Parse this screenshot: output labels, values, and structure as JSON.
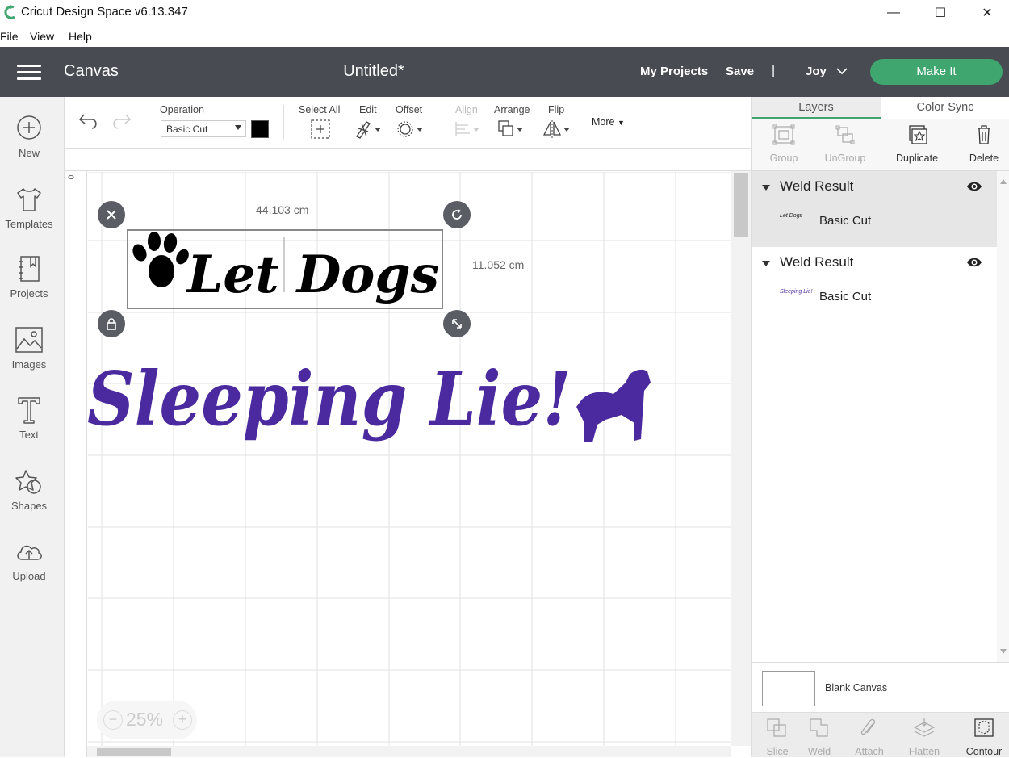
{
  "window": {
    "title": "Cricut Design Space  v6.13.347",
    "minimize": "—",
    "maximize": "☐",
    "close": "✕"
  },
  "menu": [
    "File",
    "View",
    "Help"
  ],
  "header": {
    "section": "Canvas",
    "document_title": "Untitled*",
    "my_projects": "My Projects",
    "save": "Save",
    "separator": "|",
    "user": "Joy",
    "make_it": "Make It",
    "accent_color": "#3ea66e"
  },
  "sidebar": {
    "items": [
      {
        "label": "New",
        "icon": "plus-circle-icon"
      },
      {
        "label": "Templates",
        "icon": "tshirt-icon"
      },
      {
        "label": "Projects",
        "icon": "notebook-icon"
      },
      {
        "label": "Images",
        "icon": "image-icon"
      },
      {
        "label": "Text",
        "icon": "text-t-icon"
      },
      {
        "label": "Shapes",
        "icon": "shapes-icon"
      },
      {
        "label": "Upload",
        "icon": "cloud-upload-icon"
      }
    ]
  },
  "toolbar": {
    "operation_label": "Operation",
    "operation_value": "Basic Cut",
    "operation_color": "#000000",
    "select_all": "Select All",
    "edit": "Edit",
    "offset": "Offset",
    "align": "Align",
    "arrange": "Arrange",
    "flip": "Flip",
    "more": "More"
  },
  "canvas": {
    "ruler_zero": "0",
    "width_dim": "44.103 cm",
    "height_dim": "11.052 cm",
    "text_line1": "Let Dogs",
    "text_line2": "Sleeping Lie!",
    "line2_color": "#4a2a9e",
    "zoom": "25%",
    "zoom_minus": "−",
    "zoom_plus": "+"
  },
  "panel": {
    "tabs": [
      "Layers",
      "Color Sync"
    ],
    "active_tab": "Layers",
    "tools": [
      {
        "label": "Group",
        "enabled": false
      },
      {
        "label": "UnGroup",
        "enabled": false
      },
      {
        "label": "Duplicate",
        "enabled": true
      },
      {
        "label": "Delete",
        "enabled": true
      }
    ],
    "layers": [
      {
        "name": "Weld Result",
        "sub": "Basic Cut",
        "thumb": "Let Dogs",
        "thumb_color": "#222222",
        "selected": true
      },
      {
        "name": "Weld Result",
        "sub": "Basic Cut",
        "thumb": "Sleeping Lie!",
        "thumb_color": "#4a2a9e",
        "selected": false
      }
    ],
    "blank_canvas": "Blank Canvas",
    "bottom_tools": [
      {
        "label": "Slice",
        "enabled": false
      },
      {
        "label": "Weld",
        "enabled": false
      },
      {
        "label": "Attach",
        "enabled": false
      },
      {
        "label": "Flatten",
        "enabled": false
      },
      {
        "label": "Contour",
        "enabled": true
      }
    ]
  }
}
